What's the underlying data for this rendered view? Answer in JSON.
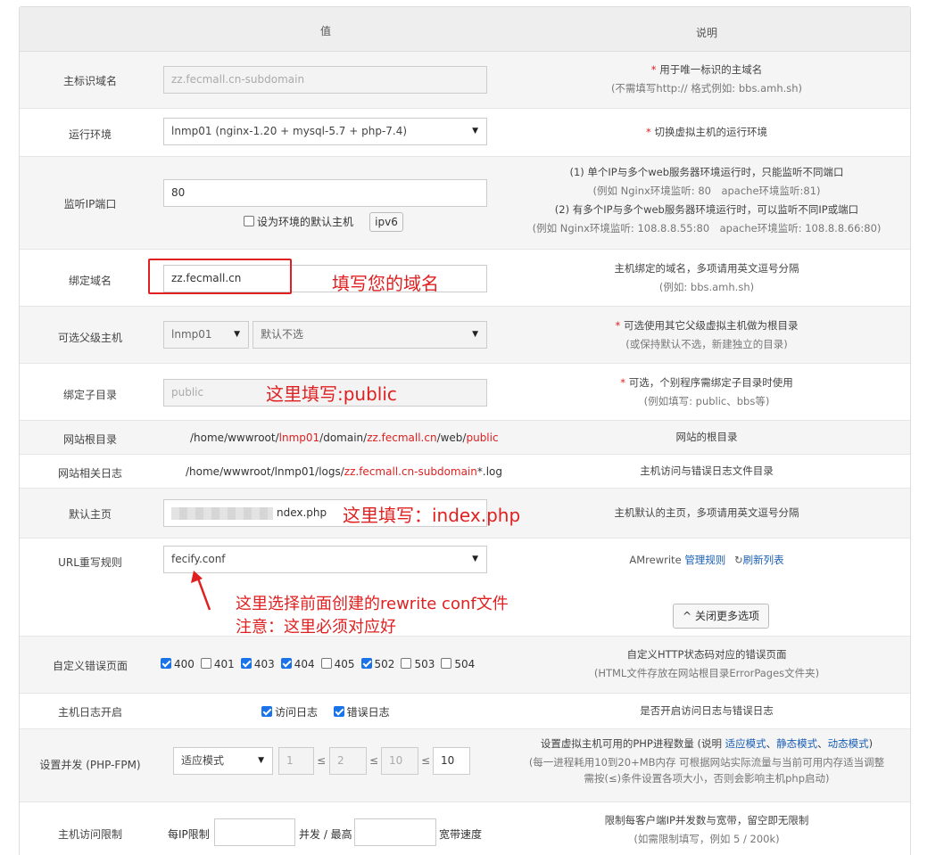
{
  "header": {
    "value_col": "值",
    "desc_col": "说明"
  },
  "domain_main": {
    "label": "主标识域名",
    "placeholder": "zz.fecmall.cn-subdomain",
    "desc_star": "*",
    "desc_line1": "用于唯一标识的主域名",
    "desc_line2": "(不需填写http:// 格式例如: bbs.amh.sh)"
  },
  "env": {
    "label": "运行环境",
    "selected": "lnmp01 (nginx-1.20 + mysql-5.7 + php-7.4)",
    "desc_star": "*",
    "desc": "切换虚拟主机的运行环境"
  },
  "port": {
    "label": "监听IP端口",
    "value": "80",
    "default_host_label": "设为环境的默认主机",
    "ipv6_label": "ipv6",
    "desc_line1": "(1) 单个IP与多个web服务器环境运行时，只能监听不同端口",
    "desc_line2": "(例如 Nginx环境监听: 80　apache环境监听:81)",
    "desc_line3": "(2) 有多个IP与多个web服务器环境运行时，可以监听不同IP或端口",
    "desc_line4": "(例如 Nginx环境监听: 108.8.8.55:80　apache环境监听: 108.8.8.66:80)"
  },
  "bind_domain": {
    "label": "绑定域名",
    "value": "zz.fecmall.cn",
    "annotation": "填写您的域名",
    "desc_line1": "主机绑定的域名，多项请用英文逗号分隔",
    "desc_line2": "(例如: bbs.amh.sh)"
  },
  "parent_host": {
    "label": "可选父级主机",
    "env_selected": "lnmp01",
    "host_selected": "默认不选",
    "desc_star": "*",
    "desc_line1": "可选使用其它父级虚拟主机做为根目录",
    "desc_line2": "(或保持默认不选，新建独立的目录)"
  },
  "bind_subdir": {
    "label": "绑定子目录",
    "placeholder": "public",
    "annotation": "这里填写:public",
    "desc_star": "*",
    "desc_line1": "可选，个别程序需绑定子目录时使用",
    "desc_line2": "(例如填写: public、bbs等)"
  },
  "web_root": {
    "label": "网站根目录",
    "p1": "/home/wwwroot/",
    "p2": "lnmp01",
    "p3": "/domain/",
    "p4": "zz.fecmall.cn",
    "p5": "/web/",
    "p6": "public",
    "desc": "网站的根目录"
  },
  "logs": {
    "label": "网站相关日志",
    "p1": "/home/wwwroot/lnmp01/logs/",
    "p2": "zz.fecmall.cn-subdomain",
    "p3": "*.log",
    "desc": "主机访问与错误日志文件目录"
  },
  "index_page": {
    "label": "默认主页",
    "value_visible": "ndex.php",
    "annotation": "这里填写：index.php",
    "desc": "主机默认的主页，多项请用英文逗号分隔"
  },
  "rewrite": {
    "label": "URL重写规则",
    "selected": "fecify.conf",
    "desc_prefix": "AMrewrite",
    "manage_link": "管理规则",
    "refresh_link": "刷新列表",
    "annotation_line1": "这里选择前面创建的rewrite conf文件",
    "annotation_line2": "注意：这里必须对应好",
    "close_more_label": "关闭更多选项"
  },
  "error_pages": {
    "label": "自定义错误页面",
    "codes": [
      {
        "code": "400",
        "checked": true
      },
      {
        "code": "401",
        "checked": false
      },
      {
        "code": "403",
        "checked": true
      },
      {
        "code": "404",
        "checked": true
      },
      {
        "code": "405",
        "checked": false
      },
      {
        "code": "502",
        "checked": true
      },
      {
        "code": "503",
        "checked": false
      },
      {
        "code": "504",
        "checked": false
      }
    ],
    "desc_line1": "自定义HTTP状态码对应的错误页面",
    "desc_line2": "(HTML文件存放在网站根目录ErrorPages文件夹)"
  },
  "host_log": {
    "label": "主机日志开启",
    "access_label": "访问日志",
    "error_label": "错误日志",
    "desc": "是否开启访问日志与错误日志"
  },
  "concurrency": {
    "label": "设置并发 (PHP-FPM)",
    "mode_selected": "适应模式",
    "v1": "1",
    "v2": "2",
    "v3": "10",
    "v4": "10",
    "le": "≤",
    "desc_line1_a": "设置虚拟主机可用的PHP进程数量 (说明 ",
    "desc_link1": "适应模式",
    "desc_sep1": "、",
    "desc_link2": "静态模式",
    "desc_sep2": "、",
    "desc_link3": "动态模式",
    "desc_line1_b": ")",
    "desc_line2": "(每一进程耗用10到20+MB内存 可根据网站实际流量与当前可用内存适当调整",
    "desc_line3": "需按(≤)条件设置各项大小，否则会影响主机php启动)"
  },
  "access_limit": {
    "label": "主机访问限制",
    "per_ip_label": "每IP限制",
    "concurrent_label": "并发 / 最高",
    "bandwidth_label": "宽带速度",
    "desc_line1": "限制每客户端IP并发数与宽带，留空即无限制",
    "desc_line2": "(如需限制填写，例如 5 / 200k)"
  },
  "colors": {
    "annotation_red": "#e02020",
    "link_blue": "#1a5fb4",
    "checkbox_blue": "#1a73e8"
  }
}
